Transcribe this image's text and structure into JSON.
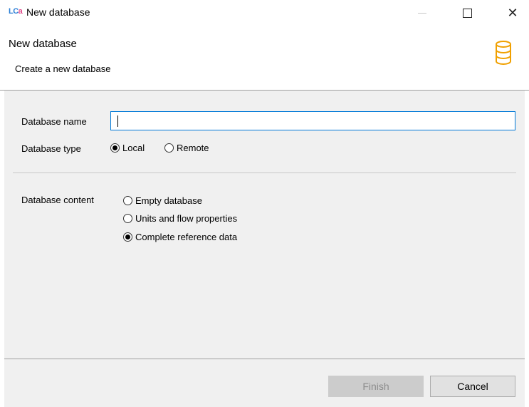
{
  "window": {
    "app_icon_text": "LCA",
    "title": "New database"
  },
  "header": {
    "title": "New database",
    "subtitle": "Create a new database"
  },
  "form": {
    "name_label": "Database name",
    "name_value": "",
    "type_label": "Database type",
    "type_options": [
      {
        "label": "Local",
        "selected": true
      },
      {
        "label": "Remote",
        "selected": false
      }
    ],
    "content_label": "Database content",
    "content_options": [
      {
        "label": "Empty database",
        "selected": false
      },
      {
        "label": "Units and flow properties",
        "selected": false
      },
      {
        "label": "Complete reference data",
        "selected": true
      }
    ]
  },
  "buttons": {
    "finish": "Finish",
    "cancel": "Cancel"
  },
  "colors": {
    "accent": "#0078d7",
    "database_icon": "#f0a000"
  }
}
